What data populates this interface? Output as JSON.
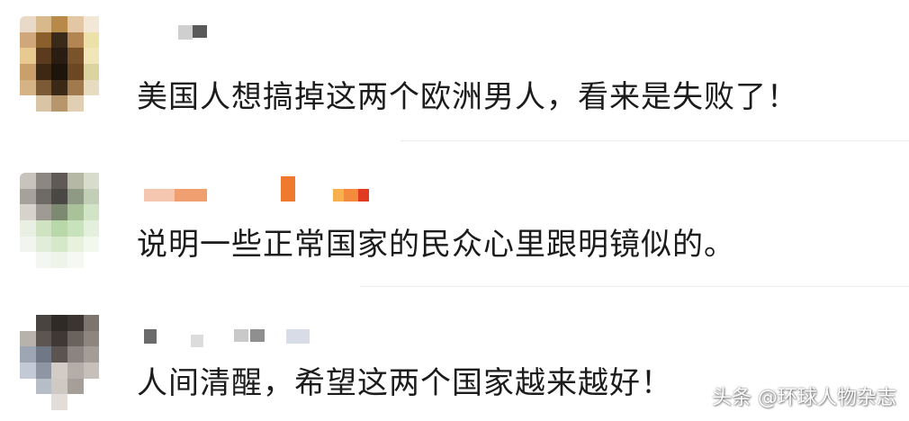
{
  "comments": [
    {
      "text": "美国人想搞掉这两个欧洲男人，看来是失败了！",
      "avatar_colors": [
        "#e9d9c8",
        "#d8b98c",
        "#b88a4a",
        "#e3c7a4",
        "#f3e7d7",
        "#ffffff",
        "#cfa77a",
        "#8a5f2c",
        "#3a2a1a",
        "#b38552",
        "#ece2a9",
        "#ffffff",
        "#e8c98f",
        "#5b3a1d",
        "#2a1c12",
        "#7a532b",
        "#f0e6b8",
        "#ffffff",
        "#c9a06a",
        "#3d2813",
        "#1e140c",
        "#6b4724",
        "#dcd4a0",
        "#ffffff",
        "#d6b384",
        "#7d5a36",
        "#3b2918",
        "#a07a4c",
        "#e8dcc0",
        "#ffffff",
        "#ffffff",
        "#d9c4a6",
        "#b7966c",
        "#e1cfb4",
        "#ffffff",
        "#ffffff"
      ],
      "name_blocks": [
        "#cfcfcf",
        "#5a5a5a",
        "#9a9a9a"
      ]
    },
    {
      "text": "说明一些正常国家的民众心里跟明镜似的。",
      "avatar_colors": [
        "#c9c3bd",
        "#8c8781",
        "#5f5a55",
        "#b6b8a6",
        "#d7dccd",
        "#ffffff",
        "#a7a19b",
        "#6e6b66",
        "#4a4844",
        "#8f9a84",
        "#c2ceb6",
        "#ffffff",
        "#d8d2cc",
        "#a09a94",
        "#7d8a72",
        "#a9c29a",
        "#d2e4c6",
        "#ffffff",
        "#e9efe3",
        "#cfe3c3",
        "#b9d8aa",
        "#c8e2bc",
        "#e4f0dd",
        "#ffffff",
        "#f2f5ef",
        "#e1ecd9",
        "#d5e8ca",
        "#e6f1de",
        "#f3f8ef",
        "#ffffff",
        "#ffffff",
        "#f4f7f1",
        "#eef4e9",
        "#f6f9f3",
        "#ffffff",
        "#ffffff"
      ],
      "name_blocks": [
        "#f5c7b0",
        "#f0a070",
        "#ef7a2f",
        "#f38a3c",
        "#f6b04e",
        "#e03a22"
      ]
    },
    {
      "text": "人间清醒，希望这两个国家越来越好！",
      "avatar_colors": [
        "#ffffff",
        "#4a4440",
        "#2e2a27",
        "#3a3531",
        "#7d746d",
        "#ffffff",
        "#b8b2ad",
        "#5c5550",
        "#3f3935",
        "#6a625c",
        "#8d857e",
        "#ffffff",
        "#9ea6b4",
        "#707887",
        "#5b5450",
        "#8c8480",
        "#a49c96",
        "#ffffff",
        "#c3cad6",
        "#8f96a3",
        "#d2cbc6",
        "#b5ada7",
        "#c7c0ba",
        "#ffffff",
        "#ffffff",
        "#b7bdc7",
        "#cfc9c4",
        "#a69f99",
        "#ffffff",
        "#ffffff",
        "#ffffff",
        "#ffffff",
        "#e2ddd9",
        "#ffffff",
        "#ffffff",
        "#ffffff"
      ],
      "name_blocks": [
        "#6b6b6b",
        "#dcdcdc",
        "#8f8f8f",
        "#c9c9c9",
        "#d8dce6"
      ]
    }
  ],
  "watermark": "头条 @环球人物杂志"
}
